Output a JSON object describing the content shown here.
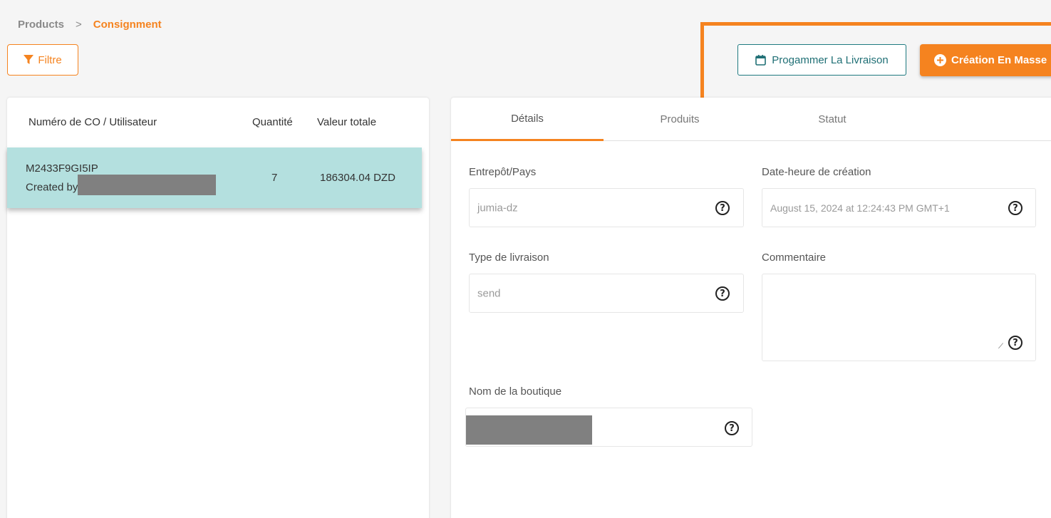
{
  "breadcrumb": {
    "products": "Products",
    "separator": ">",
    "current": "Consignment"
  },
  "toolbar": {
    "filter_label": "Filtre",
    "schedule_label": "Progammer La Livraison",
    "mass_create_label": "Création En Masse"
  },
  "list": {
    "columns": [
      "Numéro de CO / Utilisateur",
      "Quantité",
      "Valeur totale"
    ],
    "rows": [
      {
        "co": "M2433F9GI5IP",
        "created_by_prefix": "Created by",
        "quantity": "7",
        "total": "186304.04 DZD"
      }
    ]
  },
  "tabs": [
    "Détails",
    "Produits",
    "Statut"
  ],
  "details": {
    "warehouse_label": "Entrepôt/Pays",
    "warehouse_value": "jumia-dz",
    "created_label": "Date-heure de création",
    "created_value": "August 15, 2024 at 12:24:43 PM GMT+1",
    "delivery_type_label": "Type de livraison",
    "delivery_type_value": "send",
    "comment_label": "Commentaire",
    "comment_value": "",
    "shop_label": "Nom de la boutique"
  },
  "icons": {
    "help": "?"
  },
  "colors": {
    "accent": "#f5831f",
    "teal": "#1f7a80",
    "selected_row": "#b4e0df"
  }
}
